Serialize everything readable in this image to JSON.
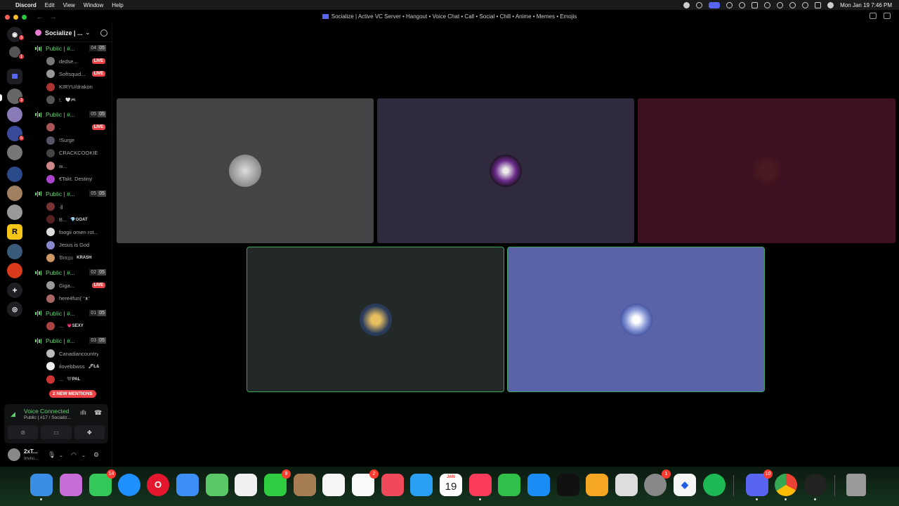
{
  "menubar": {
    "apple": "",
    "items": [
      "Discord",
      "Edit",
      "View",
      "Window",
      "Help"
    ],
    "clock": "Mon Jan 19  7:46 PM"
  },
  "window": {
    "title": "Socialize | Active VC Server • Hangout • Voice Chat • Call • Social • Chill • Anime • Memes • Emojis"
  },
  "server": {
    "name": "Socialize | ..."
  },
  "channels": [
    {
      "name": "Public | #...",
      "count": "04",
      "limit": "05",
      "users": [
        {
          "name": "dedse...",
          "live": "LIVE",
          "color": "#777"
        },
        {
          "name": "Softsquid...",
          "live": "LIVE",
          "color": "#999"
        },
        {
          "name": "KIRYU/drakon",
          "color": "#a33"
        },
        {
          "name": "!.",
          "tag": "🤍🎮",
          "color": "#555"
        }
      ]
    },
    {
      "name": "Public | #...",
      "count": "05",
      "limit": "05",
      "users": [
        {
          "name": ".",
          "live": "LIVE",
          "color": "#a55"
        },
        {
          "name": "!Surge",
          "color": "#556"
        },
        {
          "name": "CRACKCOOKIES",
          "color": "#444"
        },
        {
          "name": "w...",
          "color": "#c88"
        },
        {
          "name": "€Takt. Destiny",
          "color": "#a4c"
        }
      ]
    },
    {
      "name": "Public | #...",
      "count": "05",
      "limit": "05",
      "users": [
        {
          "name": ".jj",
          "color": "#733"
        },
        {
          "name": "B...",
          "tag": "💎GOAT",
          "color": "#522"
        },
        {
          "name": "foogii omen rot...",
          "color": "#ddd"
        },
        {
          "name": "Jesus is God",
          "color": "#88c"
        },
        {
          "name": "𝔅𝔯𝔞𝔷𝔷𝔶",
          "tag": "KRASH",
          "color": "#c96"
        }
      ]
    },
    {
      "name": "Public | #...",
      "count": "02",
      "limit": "05",
      "users": [
        {
          "name": "Giga...",
          "live": "LIVE",
          "color": "#999"
        },
        {
          "name": "here4fun( ᵔᴥᵔ",
          "color": "#a66"
        }
      ]
    },
    {
      "name": "Public | #...",
      "count": "01",
      "limit": "05",
      "users": [
        {
          "name": "...",
          "tag": "💗SEXY",
          "color": "#a44"
        }
      ]
    },
    {
      "name": "Public | #...",
      "count": "03",
      "limit": "05",
      "users": [
        {
          "name": "Canadiancountry...",
          "color": "#bbb"
        },
        {
          "name": "ilovebbwss",
          "tag": "🖋Ł&",
          "color": "#eee"
        },
        {
          "name": "...",
          "tag": "🖤PAL",
          "color": "#c33"
        }
      ]
    }
  ],
  "mentions_pill": "2 NEW MENTIONS",
  "voice": {
    "status": "Voice Connected",
    "channel": "Public | #17 / Socializ..."
  },
  "user": {
    "name": "2xT...",
    "status": "Invisi..."
  },
  "rail_badges": [
    "3",
    "1",
    "3",
    "5"
  ],
  "dock_badges": {
    "messages": "14",
    "facetime": "9",
    "reminders": "2",
    "settings": "1",
    "discord": "10"
  },
  "calendar": {
    "month": "JAN",
    "day": "19"
  }
}
